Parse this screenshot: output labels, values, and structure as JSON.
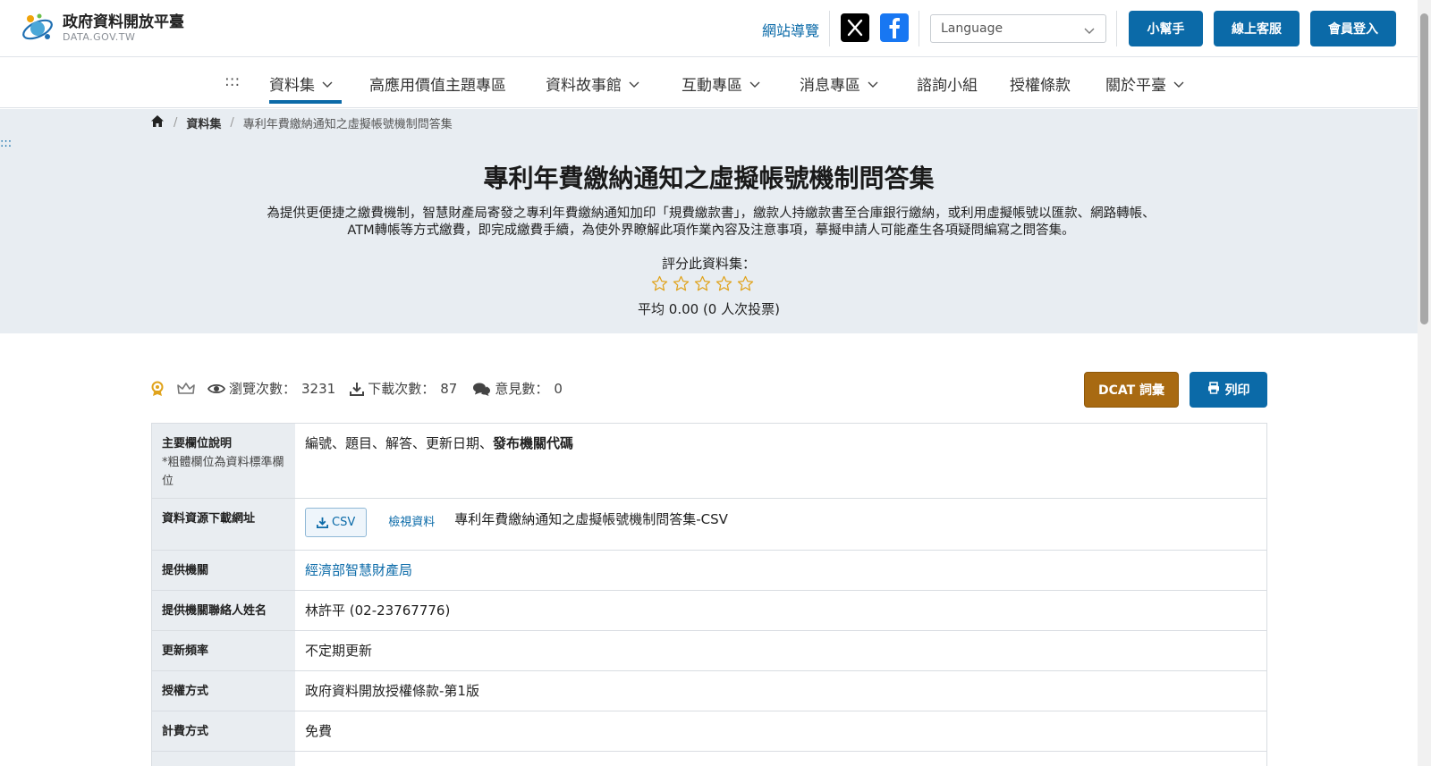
{
  "header": {
    "logo_title": "政府資料開放平臺",
    "logo_subtitle": "DATA.GOV.TW",
    "sitemap": "網站導覽",
    "language_placeholder": "Language",
    "buttons": {
      "helper": "小幫手",
      "service": "線上客服",
      "login": "會員登入"
    }
  },
  "nav": {
    "accesskey": ":::",
    "items": [
      "資料集",
      "高應用價值主題專區",
      "資料故事館",
      "互動專區",
      "消息專區",
      "諮詢小組",
      "授權條款",
      "關於平臺"
    ],
    "active": "資料集"
  },
  "breadcrumb": {
    "level1": "資料集",
    "current": "專利年費繳納通知之虛擬帳號機制問答集"
  },
  "hero": {
    "accesskey": ":::",
    "title": "專利年費繳納通知之虛擬帳號機制問答集",
    "description": "為提供更便捷之繳費機制，智慧財產局寄發之專利年費繳納通知加印「規費繳款書」，繳款人持繳款書至合庫銀行繳納，或利用虛擬帳號以匯款、網路轉帳、ATM轉帳等方式繳費，即完成繳費手續，為使外界瞭解此項作業內容及注意事項，摹擬申請人可能產生各項疑問編寫之問答集。",
    "rating_label": "評分此資料集：",
    "rating_stars": 0,
    "rating_max": 5,
    "average": "平均 0.00 (0 人次投票)"
  },
  "stats": {
    "views_label": "瀏覽次數：",
    "views": "3231",
    "downloads_label": "下載次數：",
    "downloads": "87",
    "comments_label": "意見數：",
    "comments": "0"
  },
  "actions": {
    "dcat": "DCAT 詞彙",
    "print": "列印"
  },
  "table": {
    "main_fields_label": "主要欄位說明",
    "main_fields_note": "*粗體欄位為資料標準欄位",
    "main_fields_plain": "編號、題目、解答、更新日期、",
    "main_fields_bold": "發布機關代碼",
    "download_label": "資料資源下載網址",
    "csv_button": "CSV",
    "view_data": "檢視資料",
    "resource_name": "專利年費繳納通知之虛擬帳號機制問答集-CSV",
    "provider_label": "提供機關",
    "provider": "經濟部智慧財產局",
    "contact_label": "提供機關聯絡人姓名",
    "contact": "林許平 (02-23767776)",
    "frequency_label": "更新頻率",
    "frequency": "不定期更新",
    "license_label": "授權方式",
    "license": "政府資料開放授權條款-第1版",
    "fee_label": "計費方式",
    "fee": "免費"
  },
  "colors": {
    "primary": "#0b6aa8",
    "dcat": "#a86a12",
    "hero_bg": "#e8edf2",
    "star": "#e0a31c"
  }
}
